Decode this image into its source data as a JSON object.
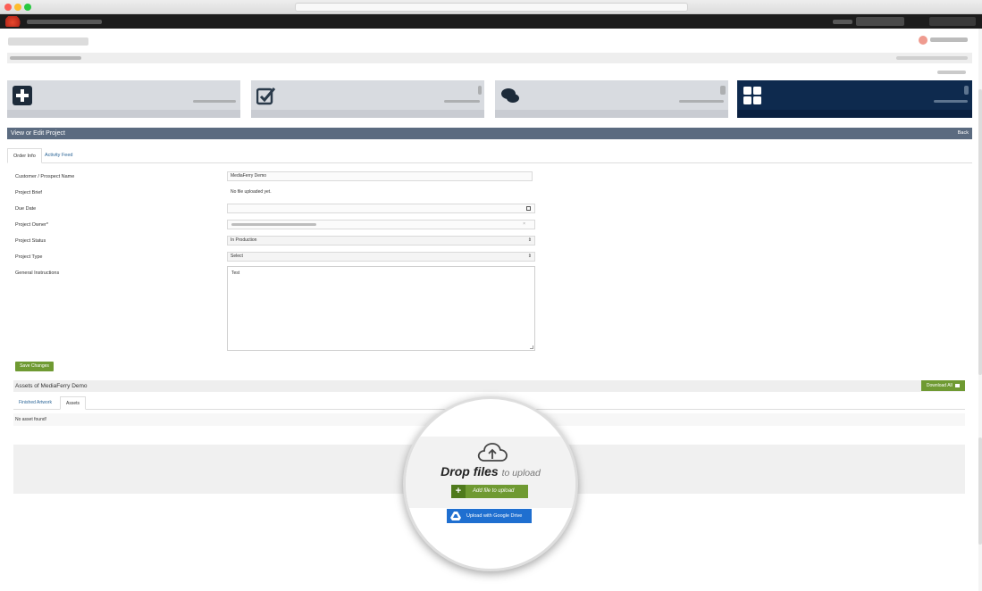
{
  "panel": {
    "title": "View or Edit Project",
    "back_label": "Back"
  },
  "tabs": [
    {
      "label": "Order Info"
    },
    {
      "label": "Activity Feed"
    }
  ],
  "form": {
    "customer_label": "Customer / Prospect Name",
    "customer_value": "MediaFerry Demo",
    "brief_label": "Project Brief",
    "brief_value": "No file uploaded yet.",
    "due_label": "Due Date",
    "due_value": "",
    "owner_label": "Project Owner*",
    "status_label": "Project Status",
    "status_value": "In Production",
    "type_label": "Project Type",
    "type_value": "Select",
    "instructions_label": "General Instructions",
    "instructions_value": "Test",
    "save_label": "Save Changes"
  },
  "assets": {
    "title": "Assets of MediaFerry Demo",
    "download_label": "Download All",
    "tabs": [
      {
        "label": "Finished Artwork"
      },
      {
        "label": "Assets"
      }
    ],
    "empty_text": "No asset found!"
  },
  "upload": {
    "drop_big": "Drop files",
    "drop_small": "to upload",
    "add_label": "Add file to upload",
    "gdrive_label": "Upload with Google Drive"
  },
  "colors": {
    "header": "#5b6b80",
    "green": "#6f9a32",
    "google_blue": "#1f6fd0",
    "tile_dark": "#0e2a4e",
    "app_bar": "#1c1c1c"
  }
}
